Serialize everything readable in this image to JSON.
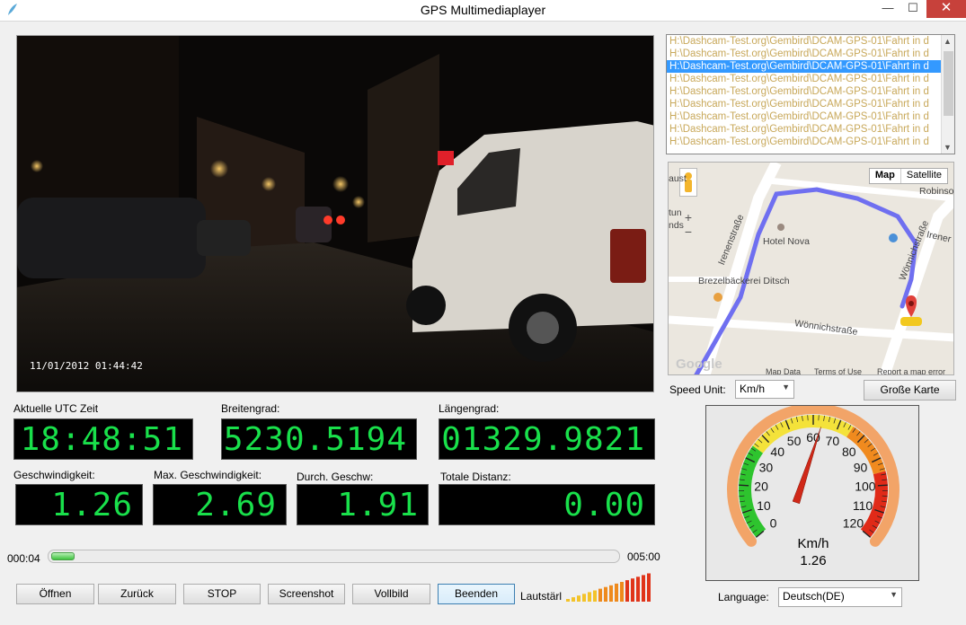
{
  "window": {
    "title": "GPS Multimediaplayer",
    "min_symbol": "—",
    "max_symbol": "☐",
    "close_symbol": "✕",
    "app_icon": "feather-icon"
  },
  "video": {
    "timestamp": "11/01/2012 01:44:42"
  },
  "playlist": {
    "selected_index": 2,
    "items": [
      "H:\\Dashcam-Test.org\\Gembird\\DCAM-GPS-01\\Fahrt in d",
      "H:\\Dashcam-Test.org\\Gembird\\DCAM-GPS-01\\Fahrt in d",
      "H:\\Dashcam-Test.org\\Gembird\\DCAM-GPS-01\\Fahrt in d",
      "H:\\Dashcam-Test.org\\Gembird\\DCAM-GPS-01\\Fahrt in d",
      "H:\\Dashcam-Test.org\\Gembird\\DCAM-GPS-01\\Fahrt in d",
      "H:\\Dashcam-Test.org\\Gembird\\DCAM-GPS-01\\Fahrt in d",
      "H:\\Dashcam-Test.org\\Gembird\\DCAM-GPS-01\\Fahrt in d",
      "H:\\Dashcam-Test.org\\Gembird\\DCAM-GPS-01\\Fahrt in d",
      "H:\\Dashcam-Test.org\\Gembird\\DCAM-GPS-01\\Fahrt in d"
    ]
  },
  "map": {
    "type_map": "Map",
    "type_satellite": "Satellite",
    "zoom_in": "+",
    "zoom_out": "−",
    "labels": {
      "robinson": "Robinso",
      "irener": "Irener",
      "irenenstrasse": "Irenenstraße",
      "wonnichstrasse_v": "Wönnichstraße",
      "wonnichstrasse": "Wönnichstraße",
      "hotel_nova": "Hotel Nova",
      "brezel": "Brezelbäckerei Ditsch",
      "aust": "aust",
      "tun": "tun",
      "nds": "nds"
    },
    "google": "Google",
    "footer_mapdata": "Map Data",
    "footer_terms": "Terms of Use",
    "footer_report": "Report a map error"
  },
  "speed_unit": {
    "label": "Speed Unit:",
    "value": "Km/h"
  },
  "big_map_button": "Große Karte",
  "fields": {
    "utc_label": "Aktuelle UTC Zeit",
    "utc_value": "18:48:51",
    "lat_label": "Breitengrad:",
    "lat_value": "5230.5194",
    "lon_label": "Längengrad:",
    "lon_value": "01329.9821",
    "speed_label": "Geschwindigkeit:",
    "speed_value": "1.26",
    "max_speed_label": "Max. Geschwindigkeit:",
    "max_speed_value": "2.69",
    "avg_speed_label": "Durch. Geschw:",
    "avg_speed_value": "1.91",
    "distance_label": "Totale Distanz:",
    "distance_value": "0.00"
  },
  "speedometer": {
    "unit": "Km/h",
    "value": 1.26,
    "value_text": "1.26",
    "min": 0,
    "max": 120,
    "ticks": [
      "0",
      "10",
      "20",
      "30",
      "40",
      "50",
      "60",
      "70",
      "80",
      "90",
      "100",
      "110",
      "120"
    ],
    "colors": {
      "green": "#2ec42e",
      "yellow": "#f4e23a",
      "orange": "#f08a1e",
      "red": "#e02a18"
    }
  },
  "playback": {
    "current_time": "000:04",
    "total_time": "005:00",
    "progress": 0.013
  },
  "buttons": {
    "open": "Öffnen",
    "back": "Zurück",
    "stop": "STOP",
    "screenshot": "Screenshot",
    "fullscreen": "Vollbild",
    "quit": "Beenden"
  },
  "volume": {
    "label": "Lautstärl",
    "level": 1.0,
    "bars": 16
  },
  "language": {
    "label": "Language:",
    "value": "Deutsch(DE)"
  }
}
